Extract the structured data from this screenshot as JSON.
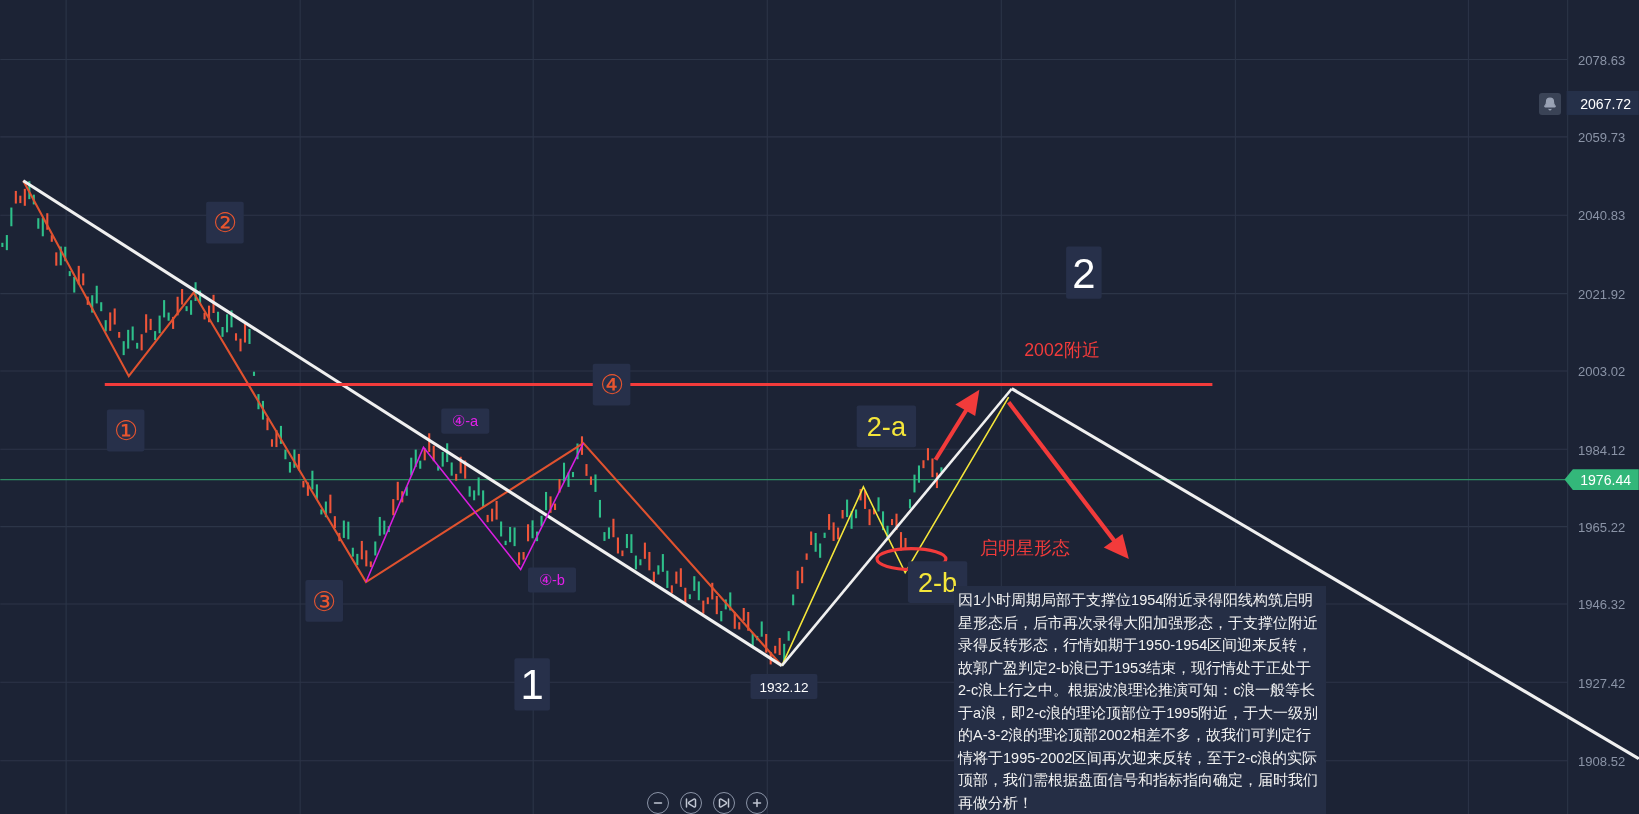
{
  "price_axis": {
    "ticks": [
      "2078.63",
      "2059.73",
      "2040.83",
      "2021.92",
      "2003.02",
      "1984.12",
      "1965.22",
      "1946.32",
      "1927.42",
      "1908.52"
    ],
    "alert_price": "2067.72",
    "current_price": "1976.44"
  },
  "wave_labels": [
    {
      "text": "①",
      "color": "#e8552f"
    },
    {
      "text": "②",
      "color": "#e8552f"
    },
    {
      "text": "③",
      "color": "#e8552f"
    },
    {
      "text": "④",
      "color": "#e8552f"
    },
    {
      "text": "④-a",
      "color": "#e020e8"
    },
    {
      "text": "④-b",
      "color": "#e020e8"
    },
    {
      "text": "1",
      "color": "#ffffff"
    },
    {
      "text": "2",
      "color": "#ffffff"
    },
    {
      "text": "2-a",
      "color": "#f5e63a"
    },
    {
      "text": "2-b",
      "color": "#f5e63a"
    }
  ],
  "low_label": "1932.12",
  "target_label": "2002附近",
  "pattern_label": "启明星形态",
  "note": "因1小时周期局部于支撑位1954附近录得阳线构筑启明星形态后，后市再次录得大阳加强形态，于支撑位附近录得反转形态，行情如期于1950-1954区间迎来反转，故郭广盈判定2-b浪已于1953结束，现行情处于正处于2-c浪上行之中。根据波浪理论推演可知：c浪一般等长于a浪，即2-c浪的理论顶部位于1995附近，于大一级别的A-3-2浪的理论顶部2002相差不多，故我们可判定行情将于1995-2002区间再次迎来反转，至于2-c浪的实际顶部，我们需根据盘面信号和指标指向确定，届时我们再做分析！"
}
